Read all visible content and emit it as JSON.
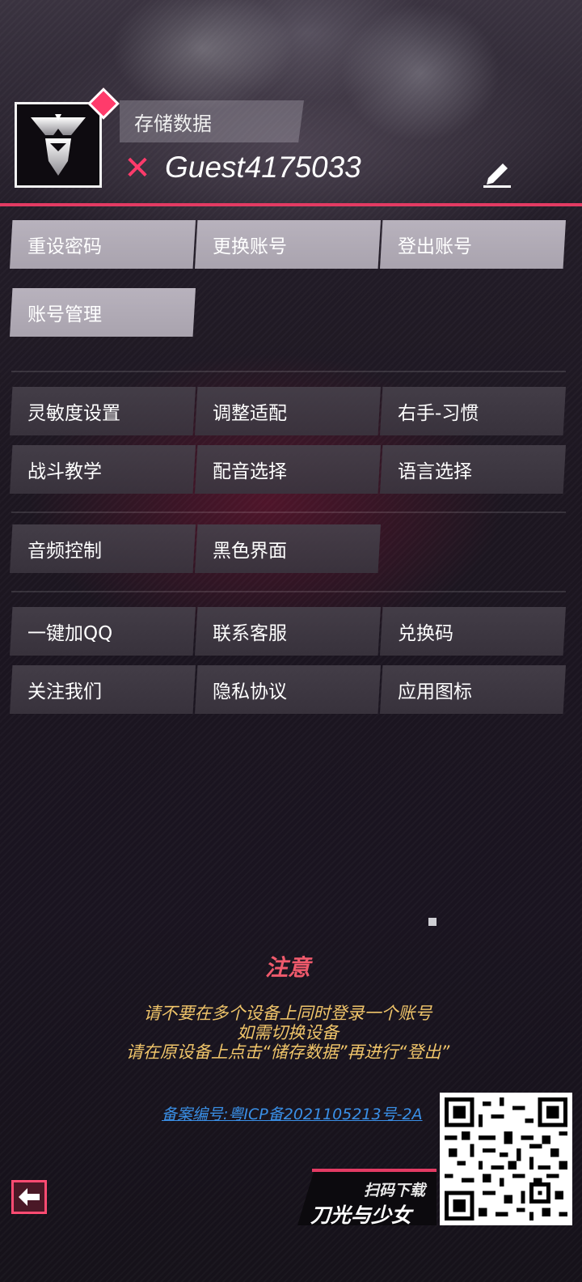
{
  "account": {
    "save_label": "存储数据",
    "username": "Guest4175033"
  },
  "account_buttons": [
    {
      "label": "重设密码",
      "style": "light"
    },
    {
      "label": "更换账号",
      "style": "light"
    },
    {
      "label": "登出账号",
      "style": "light"
    },
    {
      "label": "账号管理",
      "style": "light"
    }
  ],
  "settings_buttons": [
    {
      "label": "灵敏度设置"
    },
    {
      "label": "调整适配"
    },
    {
      "label": "右手-习惯"
    },
    {
      "label": "战斗教学"
    },
    {
      "label": "配音选择"
    },
    {
      "label": "语言选择"
    }
  ],
  "audio_buttons": [
    {
      "label": "音频控制"
    },
    {
      "label": "黑色界面"
    }
  ],
  "community_buttons": [
    {
      "label": "一键加QQ"
    },
    {
      "label": "联系客服"
    },
    {
      "label": "兑换码"
    },
    {
      "label": "关注我们"
    },
    {
      "label": "隐私协议"
    },
    {
      "label": "应用图标"
    }
  ],
  "notice": {
    "title": "注意",
    "lines": [
      "请不要在多个设备上同时登录一个账号",
      "如需切换设备",
      "请在原设备上点击“储存数据”再进行“登出”"
    ]
  },
  "icp": "备案编号:粤ICP备2021105213号-2A",
  "download": {
    "scan_label": "扫码下载",
    "game_title": "刀光与少女"
  },
  "colors": {
    "accent": "#e33b63",
    "notice_text": "#f0c56a",
    "link": "#3a8fe6",
    "button_light": "#b8b2bd",
    "button_dark": "#46404a"
  },
  "icons": [
    "avatar-emblem-icon",
    "diamond-badge-icon",
    "close-x-icon",
    "pencil-edit-icon",
    "back-arrow-icon",
    "qr-code-icon"
  ]
}
